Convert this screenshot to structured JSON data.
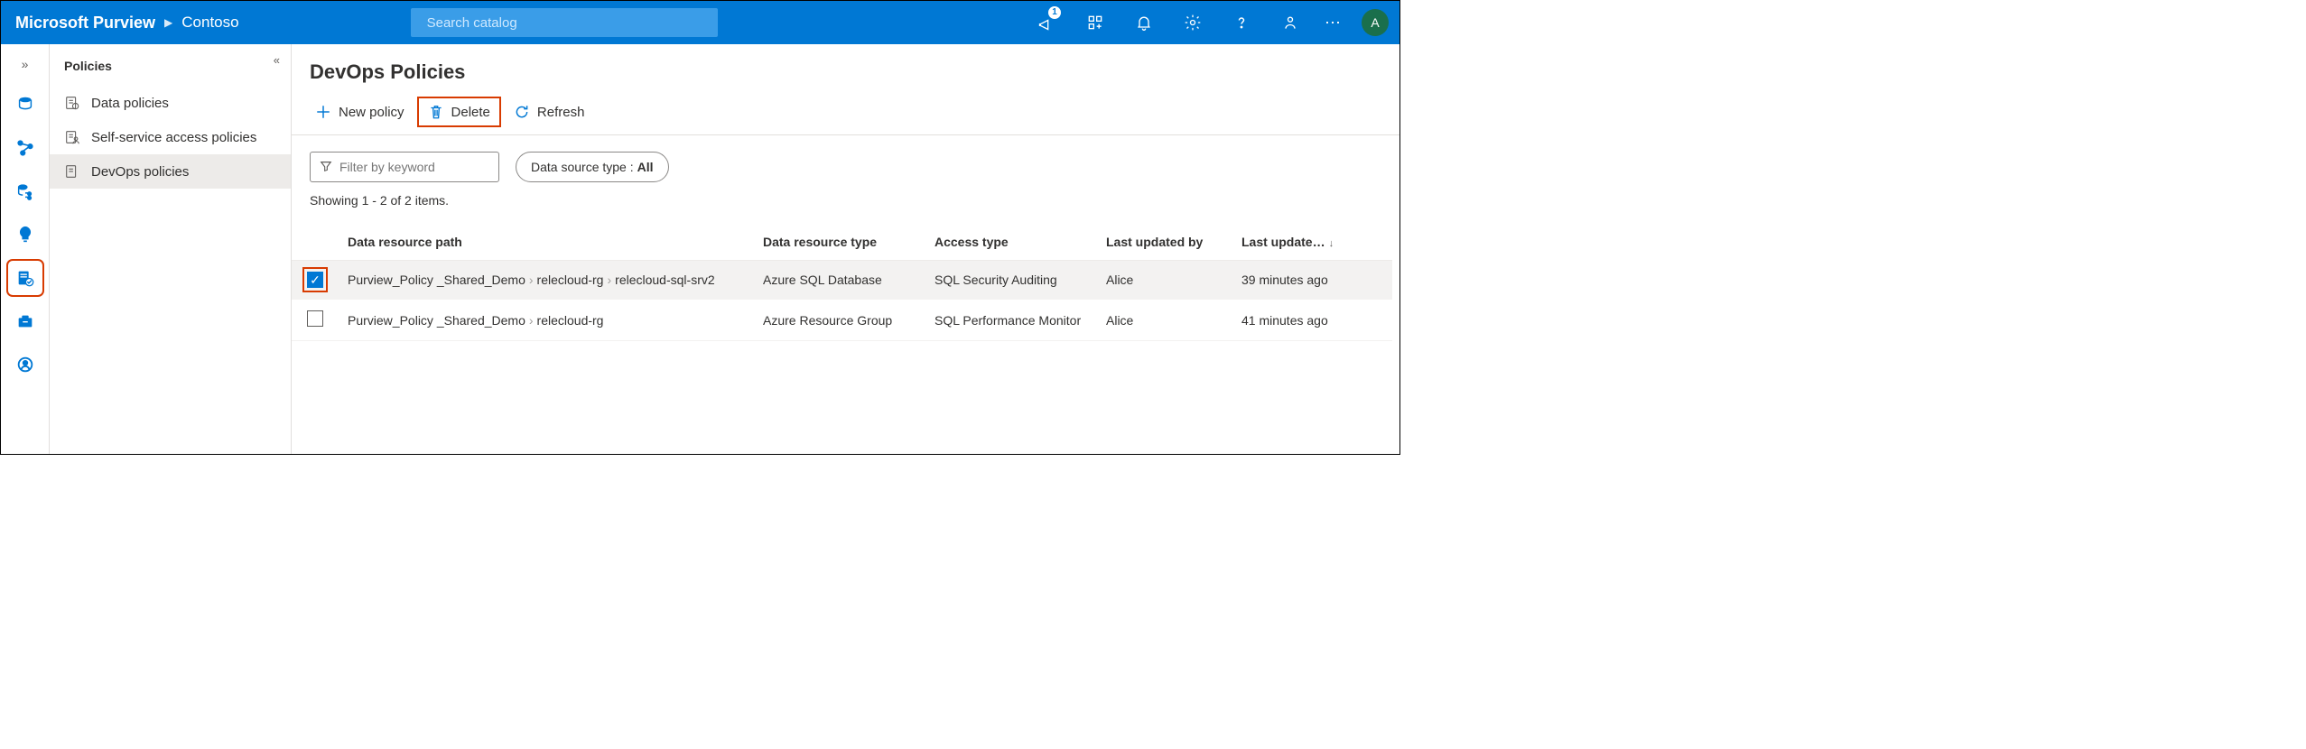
{
  "header": {
    "brand": "Microsoft Purview",
    "breadcrumb": "Contoso",
    "search_placeholder": "Search catalog",
    "notification_count": "1",
    "avatar_initial": "A"
  },
  "sidepanel": {
    "title": "Policies",
    "items": [
      {
        "label": "Data policies"
      },
      {
        "label": "Self-service access policies"
      },
      {
        "label": "DevOps policies"
      }
    ]
  },
  "page": {
    "title": "DevOps Policies",
    "commands": {
      "new": "New policy",
      "delete": "Delete",
      "refresh": "Refresh"
    },
    "filter_placeholder": "Filter by keyword",
    "pill_label": "Data source type :",
    "pill_value": "All",
    "count_text": "Showing 1 - 2 of 2 items."
  },
  "table": {
    "columns": {
      "path": "Data resource path",
      "type": "Data resource type",
      "access": "Access type",
      "updated_by": "Last updated by",
      "updated": "Last update…"
    },
    "rows": [
      {
        "selected": true,
        "path": [
          "Purview_Policy _Shared_Demo",
          "relecloud-rg",
          "relecloud-sql-srv2"
        ],
        "type": "Azure SQL Database",
        "access": "SQL Security Auditing",
        "updated_by": "Alice",
        "updated": "39 minutes ago"
      },
      {
        "selected": false,
        "path": [
          "Purview_Policy _Shared_Demo",
          "relecloud-rg"
        ],
        "type": "Azure Resource Group",
        "access": "SQL Performance Monitor",
        "updated_by": "Alice",
        "updated": "41 minutes ago"
      }
    ]
  }
}
